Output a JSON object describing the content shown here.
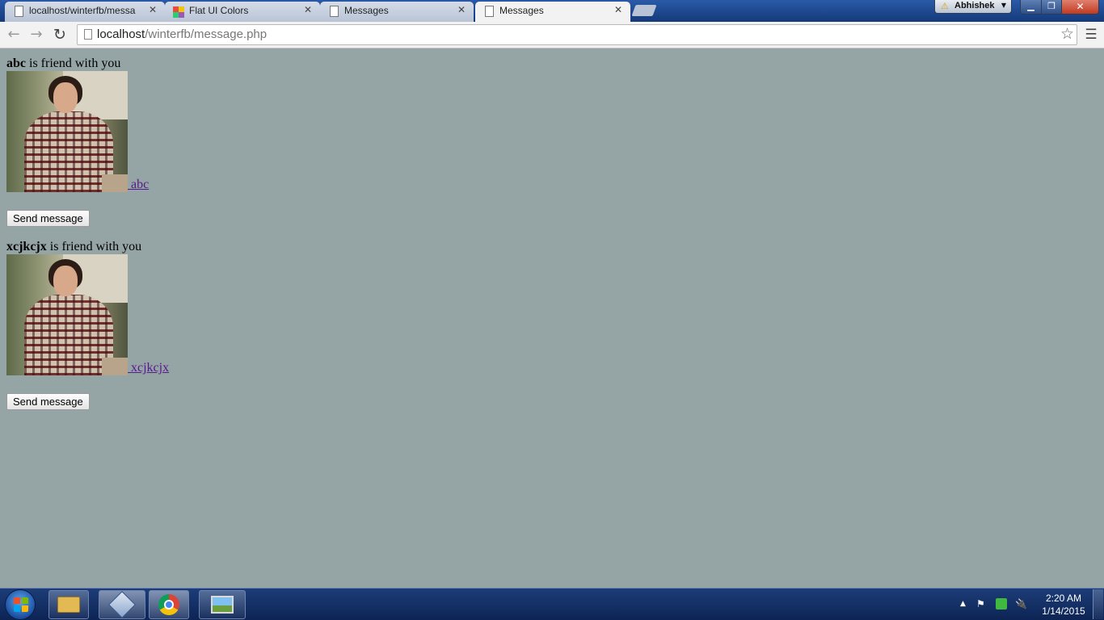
{
  "browser": {
    "tabs": [
      {
        "title": "localhost/winterfb/messa",
        "icon": "page-icon",
        "active": false
      },
      {
        "title": "Flat UI Colors",
        "icon": "flat-ui-colors-icon",
        "active": false
      },
      {
        "title": "Messages",
        "icon": "page-icon",
        "active": false
      },
      {
        "title": "Messages",
        "icon": "page-icon",
        "active": true
      }
    ],
    "close_glyph": "✕",
    "profile_name": "Abhishek",
    "address": {
      "host": "localhost",
      "path": "/winterfb/message.php"
    },
    "window_controls": {
      "minimize": "▁",
      "maximize": "❐",
      "close": "✕"
    }
  },
  "page": {
    "background": "#95a5a6",
    "friend_suffix": "is friend with you",
    "send_label": "Send message",
    "friends": [
      {
        "name": "abc",
        "link_text": " abc"
      },
      {
        "name": "xcjkcjx",
        "link_text": " xcjkcjx"
      }
    ]
  },
  "taskbar": {
    "pinned": [
      "windows-explorer-icon",
      "virtual-box-icon",
      "chrome-icon",
      "photo-viewer-icon"
    ],
    "tray_icons": [
      "show-hidden-icons-arrow",
      "action-center-flag-icon",
      "network-icon",
      "power-icon"
    ],
    "time": "2:20 AM",
    "date": "1/14/2015"
  }
}
